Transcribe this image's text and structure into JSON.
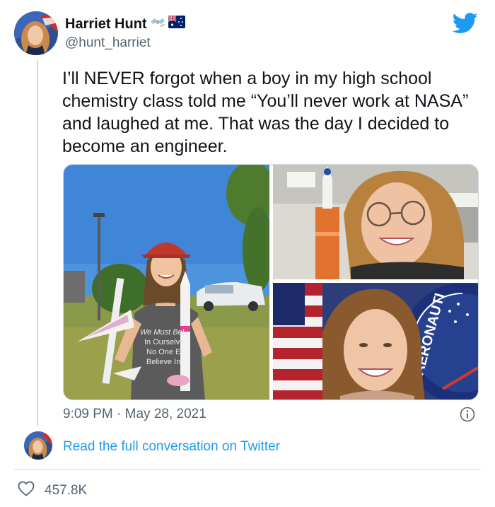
{
  "author": {
    "display_name": "Harriet Hunt",
    "handle": "@hunt_harriet"
  },
  "tweet": {
    "text": "I’ll NEVER forgot when a boy in my high school chemistry class told me “You’ll never work at NASA” and laughed at me. That was the day I decided to become an engineer.",
    "timestamp": "9:09 PM · May 28, 2021"
  },
  "photos": {
    "shirt_text": [
      "We Must Bel",
      "In Ourselve",
      "No One E",
      "Believe In"
    ],
    "badge_text": "AERONAUTI"
  },
  "footer": {
    "read_link": "Read the full conversation on Twitter",
    "like_count": "457.8K"
  },
  "icons": {
    "brand": "twitter-bird-icon",
    "info": "info-icon",
    "like": "heart-icon"
  },
  "colors": {
    "brand_blue": "#1d9bf0",
    "text_primary": "#0f1419",
    "text_secondary": "#536471",
    "border": "#cfd9de"
  }
}
